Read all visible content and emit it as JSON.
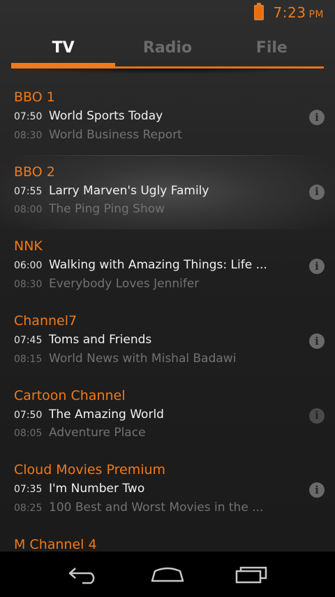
{
  "status": {
    "time": "7:23",
    "ampm": "PM"
  },
  "tabs": [
    {
      "label": "TV",
      "active": true
    },
    {
      "label": "Radio",
      "active": false
    },
    {
      "label": "File",
      "active": false
    }
  ],
  "channels": [
    {
      "name": "BBO 1",
      "now": {
        "time": "07:50",
        "title": "World Sports Today"
      },
      "next": {
        "time": "08:30",
        "title": "World Business Report"
      }
    },
    {
      "name": "BBO 2",
      "now": {
        "time": "07:55",
        "title": "Larry Marven's Ugly Family"
      },
      "next": {
        "time": "08:00",
        "title": "The Ping Ping Show"
      }
    },
    {
      "name": "NNK",
      "now": {
        "time": "06:00",
        "title": "Walking with Amazing Things: Life ..."
      },
      "next": {
        "time": "08:30",
        "title": "Everybody Loves Jennifer"
      }
    },
    {
      "name": "Channel7",
      "now": {
        "time": "07:45",
        "title": "Toms and Friends"
      },
      "next": {
        "time": "08:15",
        "title": "World News with Mishal Badawi"
      }
    },
    {
      "name": "Cartoon Channel",
      "now": {
        "time": "07:50",
        "title": "The Amazing World"
      },
      "next": {
        "time": "08:05",
        "title": "Adventure Place"
      }
    },
    {
      "name": "Cloud Movies Premium",
      "now": {
        "time": "07:35",
        "title": "I'm Number Two"
      },
      "next": {
        "time": "08:25",
        "title": "100 Best and Worst Movies in the ..."
      }
    },
    {
      "name": "M Channel 4"
    }
  ],
  "icons": {
    "battery": "battery-icon",
    "info": "info-icon",
    "back": "back-icon",
    "home": "home-icon",
    "recents": "recent-apps-icon"
  },
  "colors": {
    "accent": "#f07a1a"
  }
}
